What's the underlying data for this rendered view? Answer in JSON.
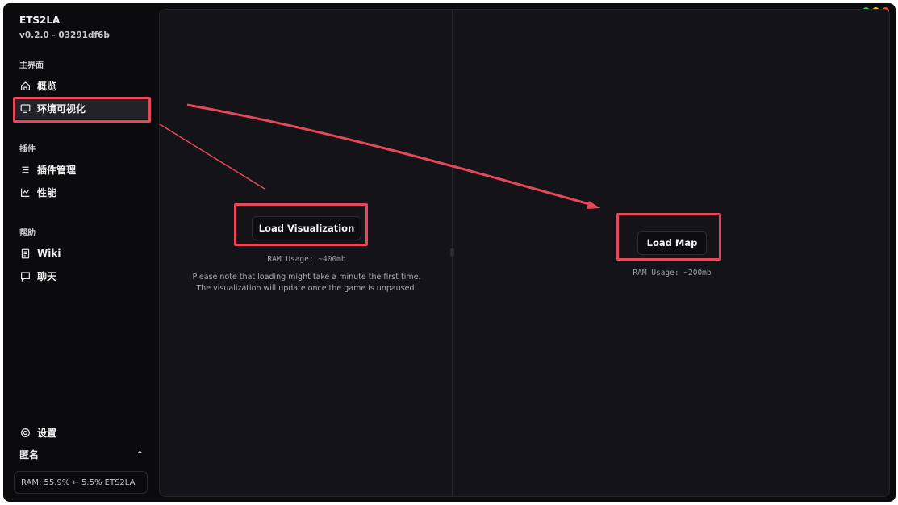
{
  "app": {
    "title": "ETS2LA",
    "version": "v0.2.0 - 03291df6b"
  },
  "sidebar": {
    "sections": [
      {
        "label": "主界面"
      },
      {
        "label": "插件"
      },
      {
        "label": "帮助"
      }
    ],
    "items": [
      {
        "label": "概览",
        "icon": "home-icon"
      },
      {
        "label": "环境可视化",
        "icon": "monitor-icon",
        "active": true
      },
      {
        "label": "插件管理",
        "icon": "list-icon"
      },
      {
        "label": "性能",
        "icon": "chart-icon"
      },
      {
        "label": "Wiki",
        "icon": "book-icon"
      },
      {
        "label": "聊天",
        "icon": "chat-icon"
      }
    ],
    "settings_label": "设置",
    "user_label": "匿名",
    "ram_status": "RAM: 55.9% ← 5.5% ETS2LA"
  },
  "visualization": {
    "button_label": "Load Visualization",
    "ram_usage": "RAM Usage: ~400mb",
    "note_line1": "Please note that loading might take a minute the first time.",
    "note_line2": "The visualization will update once the game is unpaused."
  },
  "map": {
    "button_label": "Load Map",
    "ram_usage": "RAM Usage: ~200mb"
  },
  "colors": {
    "highlight": "#e8465a",
    "background": "#0b0b0d"
  }
}
